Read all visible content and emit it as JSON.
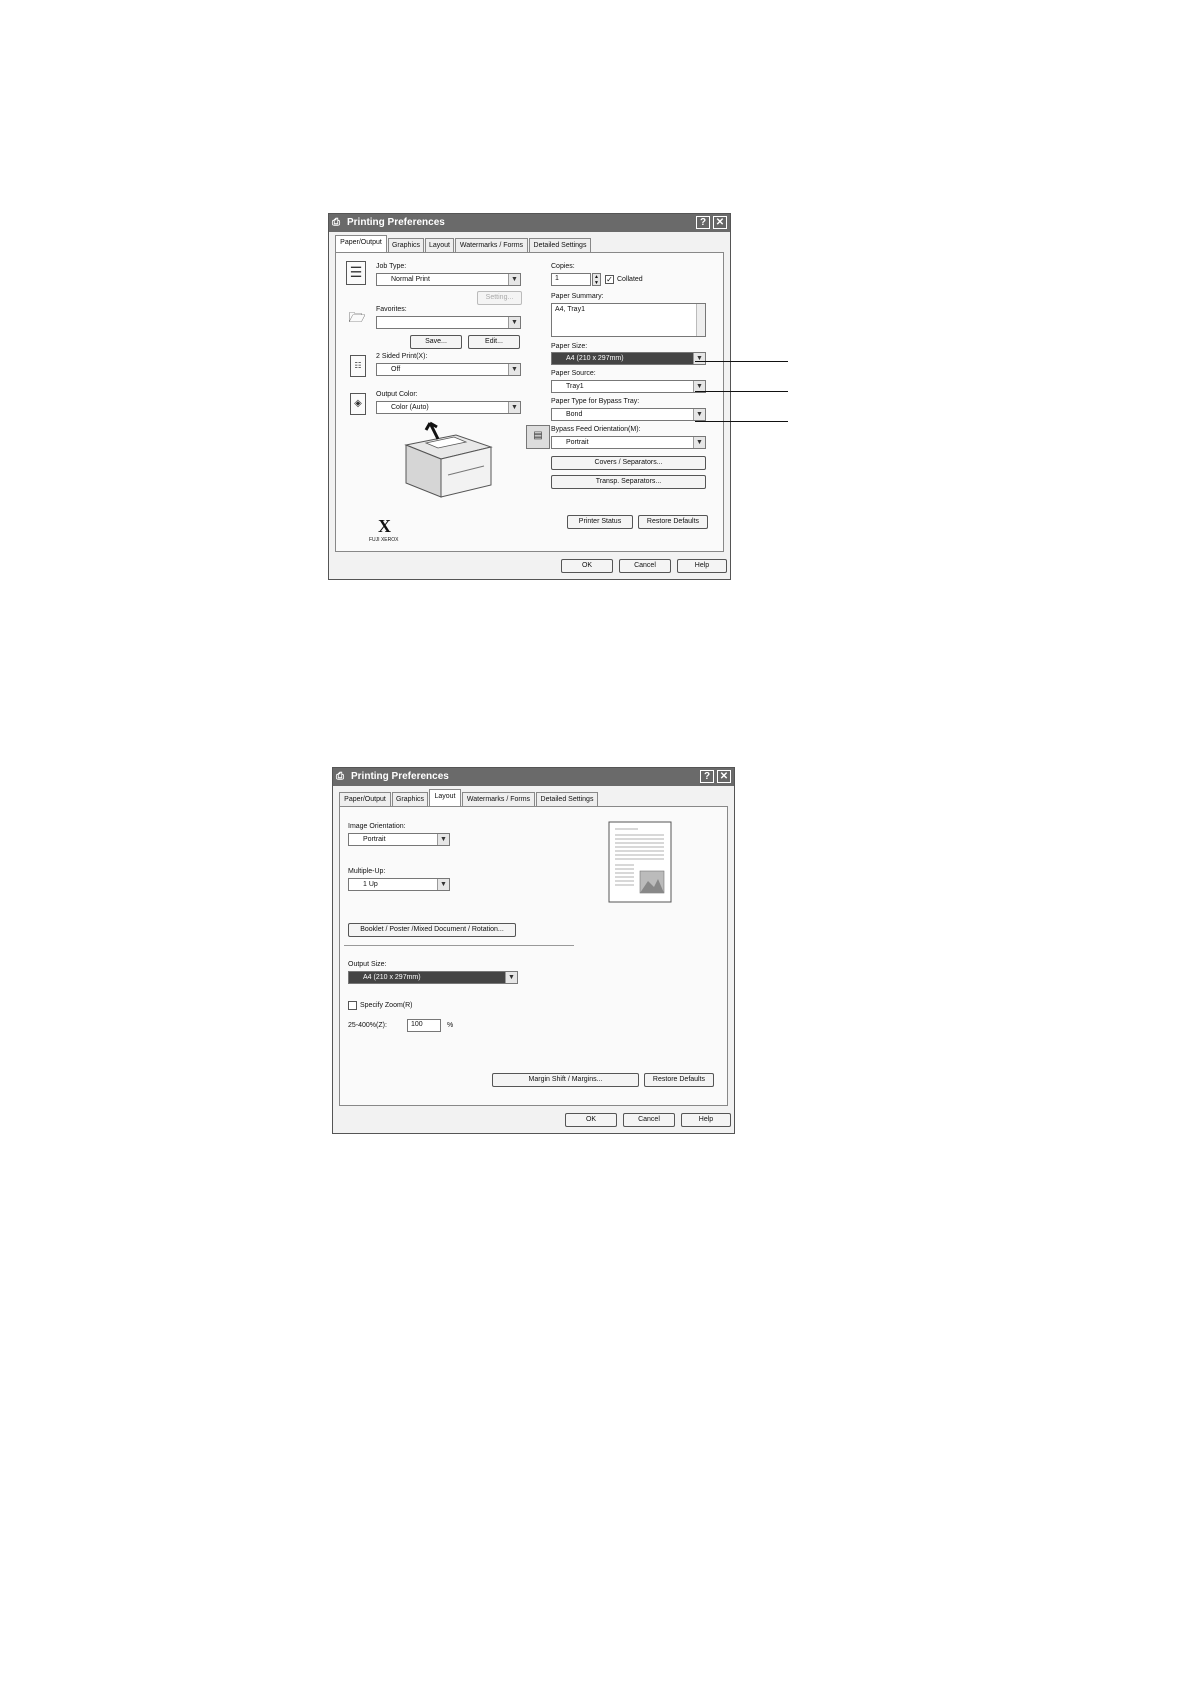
{
  "dialog1": {
    "title": "Printing Preferences",
    "help_glyph": "?",
    "close_glyph": "✕",
    "tabs": [
      "Paper/Output",
      "Graphics",
      "Layout",
      "Watermarks / Forms",
      "Detailed Settings"
    ],
    "job_type": {
      "label": "Job Type:",
      "value": "Normal Print"
    },
    "setting_button": "Setting...",
    "favorites": {
      "label": "Favorites:",
      "value": ""
    },
    "save_button": "Save...",
    "edit_button": "Edit...",
    "two_sided": {
      "label": "2 Sided Print(X):",
      "value": "Off"
    },
    "output_color": {
      "label": "Output Color:",
      "value": "Color (Auto)"
    },
    "copies": {
      "label": "Copies:",
      "value": "1"
    },
    "collated": {
      "label": "Collated",
      "checked": true
    },
    "paper_summary": {
      "label": "Paper Summary:",
      "value": "A4, Tray1"
    },
    "paper_size": {
      "label": "Paper Size:",
      "value": "A4 (210 x 297mm)"
    },
    "paper_source": {
      "label": "Paper Source:",
      "value": "Tray1"
    },
    "paper_type": {
      "label": "Paper Type for Bypass Tray:",
      "value": "Bond"
    },
    "bypass_orientation": {
      "label": "Bypass Feed Orientation(M):",
      "value": "Portrait"
    },
    "covers_button": "Covers / Separators...",
    "transp_button": "Transp. Separators...",
    "printer_status_button": "Printer Status",
    "restore_defaults_button": "Restore Defaults",
    "logo_mark": "X",
    "logo_text": "FUJI XEROX",
    "ok_button": "OK",
    "cancel_button": "Cancel",
    "help_button": "Help"
  },
  "dialog2": {
    "title": "Printing Preferences",
    "help_glyph": "?",
    "close_glyph": "✕",
    "tabs": [
      "Paper/Output",
      "Graphics",
      "Layout",
      "Watermarks / Forms",
      "Detailed Settings"
    ],
    "image_orientation": {
      "label": "Image Orientation:",
      "value": "Portrait"
    },
    "multiple_up": {
      "label": "Multiple-Up:",
      "value": "1 Up"
    },
    "booklet_button": "Booklet / Poster /Mixed Document / Rotation...",
    "output_size": {
      "label": "Output Size:",
      "value": "A4 (210 x 297mm)"
    },
    "specify_zoom": {
      "label": "Specify Zoom(R)",
      "checked": false
    },
    "zoom_range_label": "25-400%(Z):",
    "zoom_value": "100",
    "zoom_unit": "%",
    "margin_button": "Margin Shift / Margins...",
    "restore_defaults_button": "Restore Defaults",
    "ok_button": "OK",
    "cancel_button": "Cancel",
    "help_button": "Help"
  }
}
